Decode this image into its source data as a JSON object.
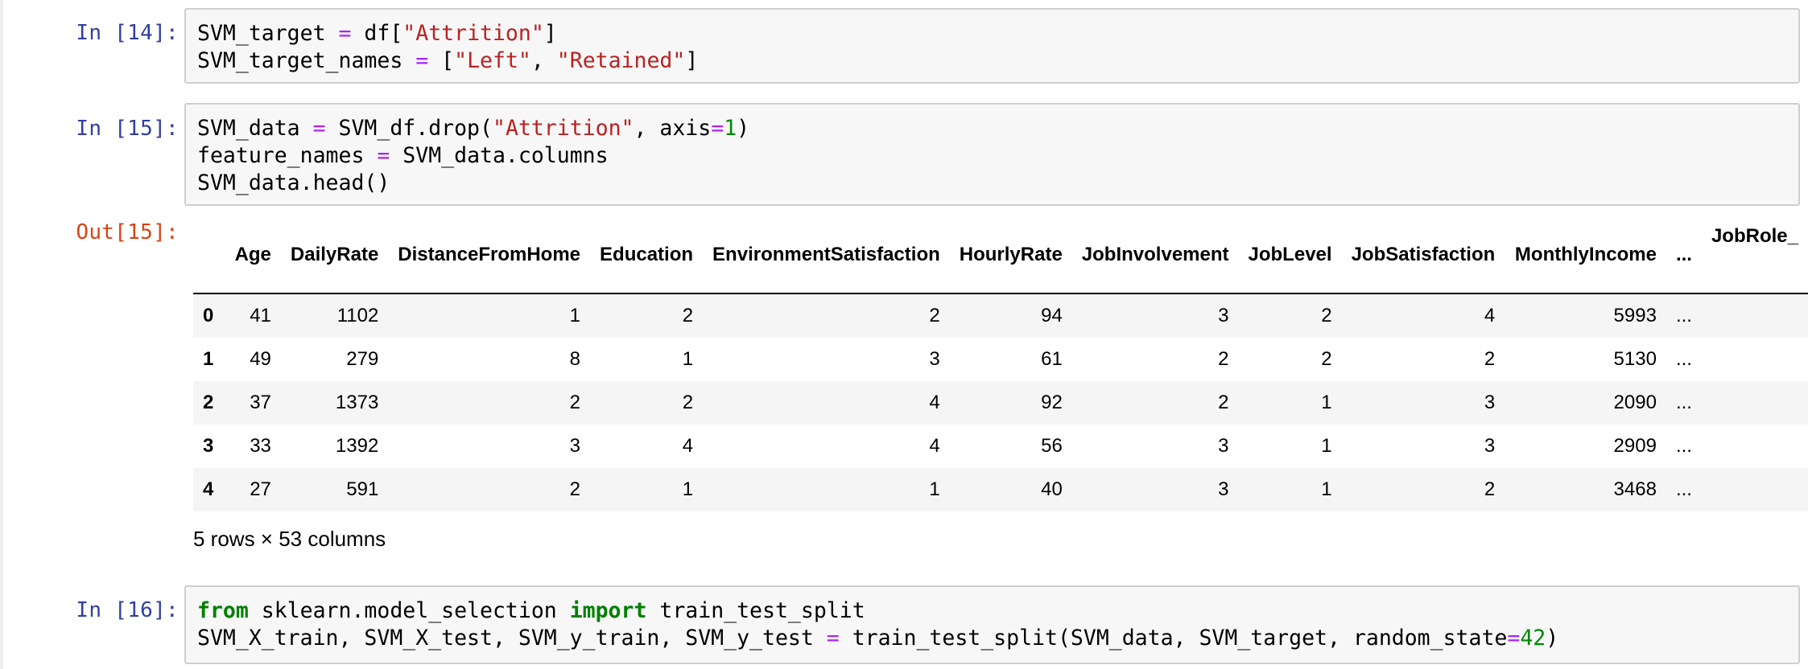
{
  "cells": {
    "c14": {
      "prompt": "In [14]:",
      "lines": [
        [
          {
            "t": "SVM_target ",
            "c": ""
          },
          {
            "t": "=",
            "c": "o"
          },
          {
            "t": " df[",
            "c": ""
          },
          {
            "t": "\"Attrition\"",
            "c": "s"
          },
          {
            "t": "]",
            "c": ""
          }
        ],
        [
          {
            "t": "SVM_target_names ",
            "c": ""
          },
          {
            "t": "=",
            "c": "o"
          },
          {
            "t": " [",
            "c": ""
          },
          {
            "t": "\"Left\"",
            "c": "s"
          },
          {
            "t": ", ",
            "c": ""
          },
          {
            "t": "\"Retained\"",
            "c": "s"
          },
          {
            "t": "]",
            "c": ""
          }
        ]
      ]
    },
    "c15": {
      "prompt": "In [15]:",
      "out_prompt": "Out[15]:",
      "lines": [
        [
          {
            "t": "SVM_data ",
            "c": ""
          },
          {
            "t": "=",
            "c": "o"
          },
          {
            "t": " SVM_df.drop(",
            "c": ""
          },
          {
            "t": "\"Attrition\"",
            "c": "s"
          },
          {
            "t": ", axis",
            "c": ""
          },
          {
            "t": "=",
            "c": "o"
          },
          {
            "t": "1",
            "c": "n"
          },
          {
            "t": ")",
            "c": ""
          }
        ],
        [
          {
            "t": "feature_names ",
            "c": ""
          },
          {
            "t": "=",
            "c": "o"
          },
          {
            "t": " SVM_data.columns",
            "c": ""
          }
        ],
        [
          {
            "t": "SVM_data.head()",
            "c": ""
          }
        ]
      ]
    },
    "c16": {
      "prompt": "In [16]:",
      "lines": [
        [
          {
            "t": "from",
            "c": "k"
          },
          {
            "t": " sklearn.model_selection ",
            "c": ""
          },
          {
            "t": "import",
            "c": "k"
          },
          {
            "t": " train_test_split",
            "c": ""
          }
        ],
        [
          {
            "t": "SVM_X_train, SVM_X_test, SVM_y_train, SVM_y_test ",
            "c": ""
          },
          {
            "t": "=",
            "c": "o"
          },
          {
            "t": " train_test_split(SVM_data, SVM_target, random_state",
            "c": ""
          },
          {
            "t": "=",
            "c": "o"
          },
          {
            "t": "42",
            "c": "n"
          },
          {
            "t": ")",
            "c": ""
          }
        ]
      ]
    }
  },
  "dataframe": {
    "columns": [
      "",
      "Age",
      "DailyRate",
      "DistanceFromHome",
      "Education",
      "EnvironmentSatisfaction",
      "HourlyRate",
      "JobInvolvement",
      "JobLevel",
      "JobSatisfaction",
      "MonthlyIncome",
      "...",
      "JobRole_"
    ],
    "rows": [
      [
        "0",
        "41",
        "1102",
        "1",
        "2",
        "2",
        "94",
        "3",
        "2",
        "4",
        "5993",
        "...",
        ""
      ],
      [
        "1",
        "49",
        "279",
        "8",
        "1",
        "3",
        "61",
        "2",
        "2",
        "2",
        "5130",
        "...",
        ""
      ],
      [
        "2",
        "37",
        "1373",
        "2",
        "2",
        "4",
        "92",
        "2",
        "1",
        "3",
        "2090",
        "...",
        ""
      ],
      [
        "3",
        "33",
        "1392",
        "3",
        "4",
        "4",
        "56",
        "3",
        "1",
        "3",
        "2909",
        "...",
        ""
      ],
      [
        "4",
        "27",
        "591",
        "2",
        "1",
        "1",
        "40",
        "3",
        "1",
        "2",
        "3468",
        "...",
        ""
      ]
    ],
    "summary": "5 rows × 53 columns"
  }
}
